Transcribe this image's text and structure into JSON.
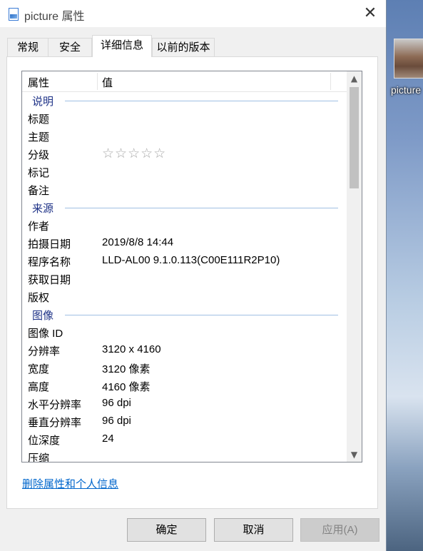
{
  "window": {
    "title": "picture 属性",
    "close_glyph": "✕"
  },
  "tabs": [
    {
      "label": "常规"
    },
    {
      "label": "安全"
    },
    {
      "label": "详细信息",
      "active": true
    },
    {
      "label": "以前的版本"
    }
  ],
  "list": {
    "headers": {
      "property": "属性",
      "value": "值"
    },
    "sections": {
      "description": {
        "title": "说明",
        "rows": [
          {
            "key": "标题",
            "value": ""
          },
          {
            "key": "主题",
            "value": ""
          },
          {
            "key": "分级",
            "value": "",
            "stars": "☆☆☆☆☆"
          },
          {
            "key": "标记",
            "value": ""
          },
          {
            "key": "备注",
            "value": ""
          }
        ]
      },
      "origin": {
        "title": "来源",
        "rows": [
          {
            "key": "作者",
            "value": ""
          },
          {
            "key": "拍摄日期",
            "value": "2019/8/8 14:44"
          },
          {
            "key": "程序名称",
            "value": "LLD-AL00 9.1.0.113(C00E111R2P10)"
          },
          {
            "key": "获取日期",
            "value": ""
          },
          {
            "key": "版权",
            "value": ""
          }
        ]
      },
      "image": {
        "title": "图像",
        "rows": [
          {
            "key": "图像 ID",
            "value": ""
          },
          {
            "key": "分辨率",
            "value": "3120 x 4160"
          },
          {
            "key": "宽度",
            "value": "3120 像素"
          },
          {
            "key": "高度",
            "value": "4160 像素"
          },
          {
            "key": "水平分辨率",
            "value": "96 dpi"
          },
          {
            "key": "垂直分辨率",
            "value": "96 dpi"
          },
          {
            "key": "位深度",
            "value": "24"
          },
          {
            "key": "压缩",
            "value": ""
          }
        ]
      }
    }
  },
  "remove_link": "删除属性和个人信息",
  "buttons": {
    "ok": "确定",
    "cancel": "取消",
    "apply": "应用(A)"
  },
  "desktop": {
    "icon_label": "picture"
  },
  "colors": {
    "group_title": "#1e3287",
    "link": "#0066cc",
    "group_line": "#a0bfe3"
  }
}
